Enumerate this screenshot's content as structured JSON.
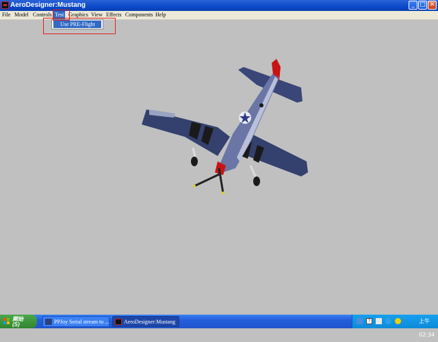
{
  "window": {
    "title": "AeroDesigner:Mustang",
    "controls": {
      "minimize": "_",
      "maximize": "□",
      "close": "✕"
    }
  },
  "menubar": {
    "items": [
      "File",
      "Model",
      "Controls",
      "Test",
      "Graphics",
      "View",
      "Effects",
      "Components",
      "Help"
    ],
    "active": "Test"
  },
  "dropdown": {
    "items": [
      "Use PRE-Flight"
    ]
  },
  "taskbar": {
    "start_label_line1": "開始",
    "start_label_line2": "(S)",
    "tasks": [
      "PPJoy Serial stream to ...",
      "AeroDesigner:Mustang"
    ],
    "clock": "上午 02:34"
  },
  "colors": {
    "titlebar": "#0a49c9",
    "viewport": "#c0c0c0",
    "aircraft_body": "#3a4677",
    "aircraft_nose": "#c81414"
  },
  "icons": [
    "app-icon",
    "start-logo-icon",
    "task-joystick-icon",
    "task-aircraft-icon",
    "tray-keyboard-icon",
    "tray-help-icon",
    "tray-network-icon",
    "tray-language-icon",
    "tray-volume-icon"
  ]
}
